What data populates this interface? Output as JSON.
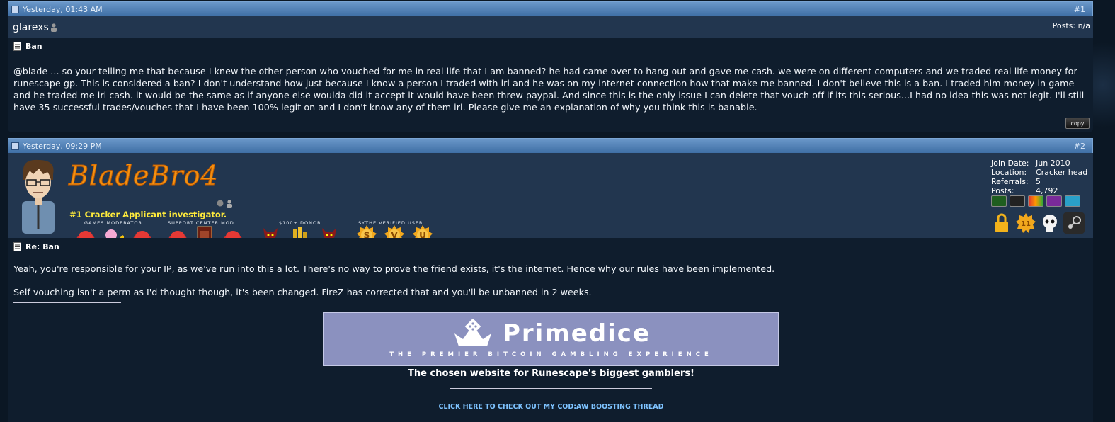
{
  "post1": {
    "date": "Yesterday, 01:43 AM",
    "number": "#1",
    "username": "glarexs",
    "posts_label": "Posts:",
    "posts_value": "n/a",
    "title": "Ban",
    "message": "@blade ... so your telling me that because I knew the other person who vouched for me in real life that I am banned? he had came over to hang out and gave me cash. we were on different computers and we traded real life money for runescape gp. This is considered a ban? I don't understand how just because I know a person I traded with irl and he was on my internet connection how that make me banned. I don't believe this is a ban. I traded him money in game and he traded me irl cash. it would be the same as if anyone else woulda did it accept it would have been threw paypal. And since this is the only issue I can delete that vouch off if its this serious...I had no idea this was not legit. I'll still have 35 successful trades/vouches that I have been 100% legit on and I don't know any of them irl. Please give me an explanation of why you think this is banable.",
    "copy_label": "copy"
  },
  "post2": {
    "date": "Yesterday, 09:29 PM",
    "number": "#2",
    "username": "BladeBro4",
    "user_title": "#1 Cracker Applicant investigator.",
    "group_labels": {
      "games_mod": "GAMES MODERATOR",
      "support_mod": "SUPPORT CENTER MOD",
      "donor": "$100+ DONOR",
      "verified": "SYTHE VERIFIED USER"
    },
    "verified_letters": [
      "S",
      "V",
      "U"
    ],
    "rank_badge": "11",
    "info": [
      {
        "key": "Join Date:",
        "value": "Jun 2010"
      },
      {
        "key": "Location:",
        "value": "Cracker head"
      },
      {
        "key": "Referrals:",
        "value": "5"
      },
      {
        "key": "Posts:",
        "value": "4,792"
      }
    ],
    "title": "Re: Ban",
    "paragraph1": "Yeah, you're responsible for your IP, as we've run into this a lot. There's no way to prove the friend exists, it's the internet. Hence why our rules have been implemented.",
    "paragraph2": "Self vouching isn't a perm as I'd thought though, it's been changed. FireZ has corrected that and you'll be unbanned in 2 weeks.",
    "banner_title": "Primedice",
    "banner_subtitle": "THE PREMIER BITCOIN GAMBLING EXPERIENCE",
    "banner_caption": "The chosen website for Runescape's biggest gamblers!",
    "link_text": "CLICK HERE TO CHECK OUT MY COD:AW BOOSTING THREAD"
  },
  "colors": {
    "header_blue": "#4f7fb5",
    "userbar": "#22364f",
    "postbody": "#0f1d2d",
    "username_orange": "#f39112",
    "title_yellow": "#ffeb3b",
    "link_blue": "#7ec3ff"
  }
}
